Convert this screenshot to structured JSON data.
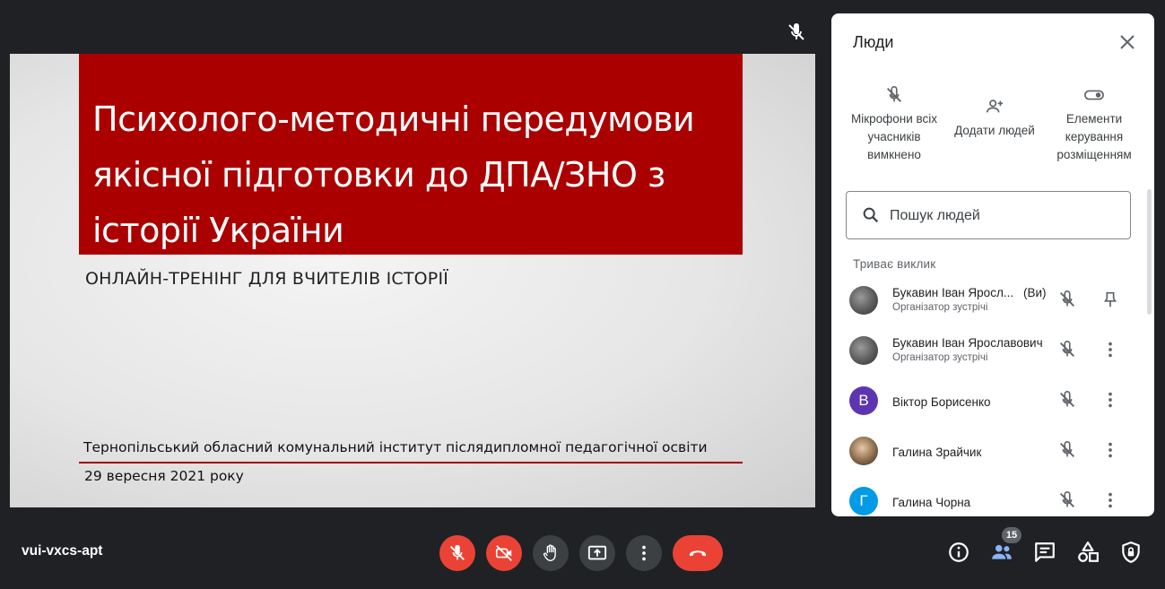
{
  "slide": {
    "title": "Психолого-методичні передумови якісної підготовки до ДПА/ЗНО з історії України",
    "subtitle": "ОНЛАЙН-ТРЕНІНГ ДЛЯ ВЧИТЕЛІВ ІСТОРІЇ",
    "institution": "Тернопільський обласний комунальний інститут післядипломної педагогічної освіти",
    "date": "29 вересня 2021 року",
    "accent_color": "#aa0000"
  },
  "panel": {
    "title": "Люди",
    "actions": {
      "mute_all": "Мікрофони всіх учасників вимкнено",
      "add_people": "Додати людей",
      "host_controls": "Елементи керування розміщенням"
    },
    "search": {
      "placeholder": "Пошук людей",
      "value": ""
    },
    "section_label": "Триває виклик",
    "participants": [
      {
        "name": "Букавин Іван Яросл...",
        "you": "(Ви)",
        "role": "Організатор зустрічі",
        "avatar": "photo",
        "mic": "muted"
      },
      {
        "name": "Букавин Іван Ярославович",
        "role": "Організатор зустрічі",
        "avatar": "photo",
        "mic": "muted"
      },
      {
        "name": "Віктор Борисенко",
        "initial": "В",
        "avatar_color": "#5e35b1",
        "mic": "muted"
      },
      {
        "name": "Галина Зрайчик",
        "avatar": "photo",
        "mic": "muted"
      },
      {
        "name": "Галина Чорна",
        "initial": "Г",
        "avatar_color": "#039be5",
        "mic": "muted"
      }
    ]
  },
  "bottom_bar": {
    "meeting_code": "vui-vxcs-apt",
    "people_count": "15",
    "icons": [
      "mic-off-icon",
      "camera-off-icon",
      "raise-hand-icon",
      "present-screen-icon",
      "more-options-icon",
      "end-call-icon",
      "info-icon",
      "people-icon",
      "chat-icon",
      "activities-icon",
      "host-controls-icon"
    ]
  },
  "colors": {
    "background": "#202124",
    "danger": "#ea4335",
    "control": "#3c4043"
  }
}
